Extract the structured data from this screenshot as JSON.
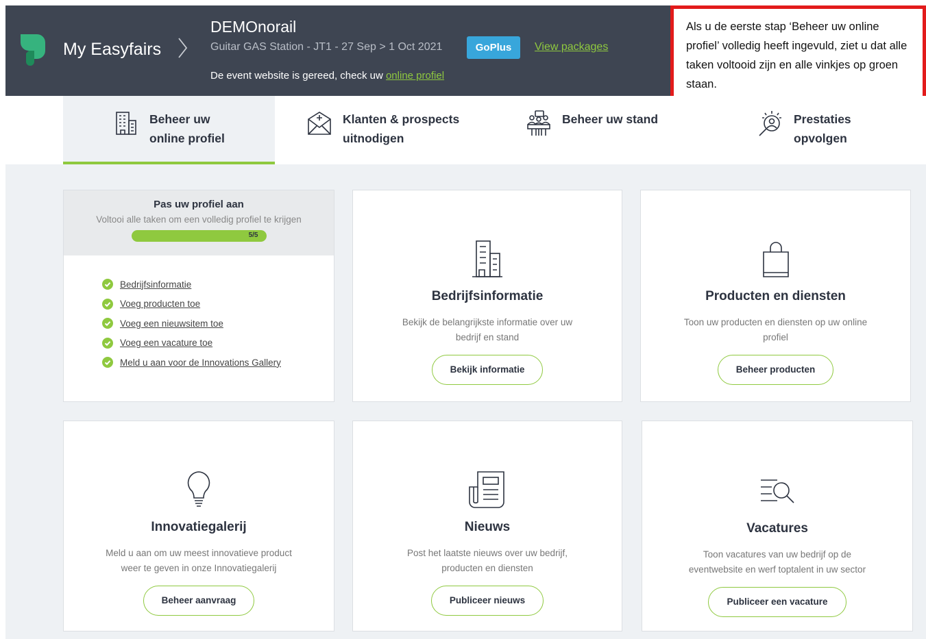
{
  "header": {
    "brand": "My Easyfairs",
    "event_title": "DEMOnorail",
    "event_meta": "Guitar GAS Station  -  JT1  -  27 Sep > 1 Oct 2021",
    "badge": "GoPlus",
    "view_link": "View packages",
    "status_prefix": "De event website is gereed, check uw ",
    "status_link": "online profiel"
  },
  "note": "Als u de eerste stap ‘Beheer uw online profiel’ volledig heeft ingevuld, ziet u dat alle taken voltooid zijn en alle vinkjes op groen staan.",
  "tabs": [
    {
      "line1": "Beheer uw",
      "line2": "online profiel",
      "icon": "building-icon"
    },
    {
      "line1": "Klanten & prospects",
      "line2": "uitnodigen",
      "icon": "envelope-plus-icon"
    },
    {
      "line1": "Beheer uw stand",
      "line2": "",
      "icon": "stand-icon"
    },
    {
      "line1": "Prestaties",
      "line2": "opvolgen",
      "icon": "magnifier-person-icon"
    }
  ],
  "profile": {
    "title": "Pas uw profiel aan",
    "subtitle": "Voltooi alle taken om een volledig profiel te krijgen",
    "progress_label": "5/5",
    "progress_value": 1.0,
    "tasks": [
      "Bedrijfsinformatie",
      "Voeg producten toe",
      "Voeg een nieuwsitem toe",
      "Voeg een vacature toe",
      "Meld u aan voor de Innovations Gallery"
    ]
  },
  "cards": [
    {
      "title": "Bedrijfsinformatie",
      "desc": "Bekijk de belangrijkste informatie over uw bedrijf en stand",
      "button": "Bekijk informatie",
      "icon": "building-icon"
    },
    {
      "title": "Producten en diensten",
      "desc": "Toon uw producten en diensten op uw online profiel",
      "button": "Beheer producten",
      "icon": "shopping-bag-icon"
    },
    {
      "title": "Innovatiegalerij",
      "desc": "Meld u aan om uw meest innovatieve product weer te geven in onze Innovatiegalerij",
      "button": "Beheer aanvraag",
      "icon": "lightbulb-icon"
    },
    {
      "title": "Nieuws",
      "desc": "Post het laatste nieuws over uw bedrijf, producten en diensten",
      "button": "Publiceer nieuws",
      "icon": "newspaper-icon"
    },
    {
      "title": "Vacatures",
      "desc": "Toon vacatures van uw bedrijf op de eventwebsite en werf toptalent in uw sector",
      "button": "Publiceer een vacature",
      "icon": "list-search-icon"
    }
  ],
  "colors": {
    "header_bg": "#3e4552",
    "accent": "#8fc93f",
    "badge": "#38a6db",
    "note_border": "#e21b1b"
  }
}
